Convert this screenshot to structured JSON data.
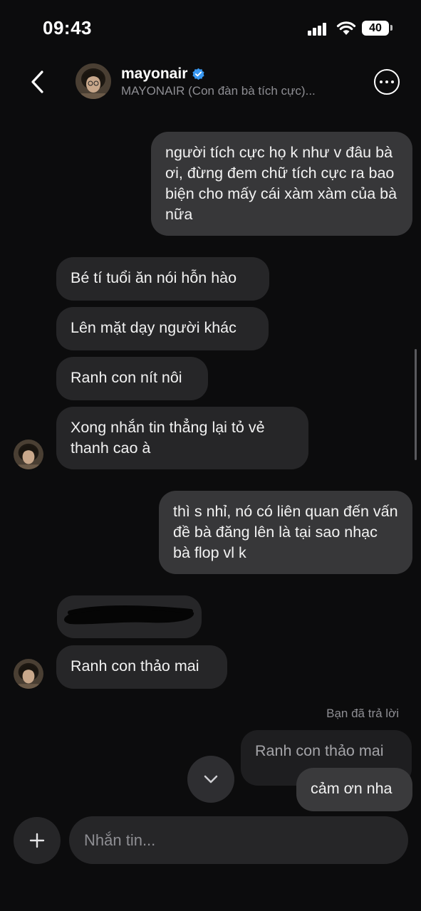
{
  "status_bar": {
    "time": "09:43",
    "battery": "40",
    "icons": [
      "signal-icon",
      "wifi-icon",
      "battery-icon"
    ]
  },
  "header": {
    "name": "mayonair",
    "verified": true,
    "subtitle": "MAYONAIR (Con đàn bà tích cực)...",
    "icons": [
      "back-arrow-icon",
      "verified-badge-icon",
      "more-options-icon"
    ]
  },
  "messages": {
    "m1": "người tích cực họ k như v đâu bà ơi, đừng đem chữ tích cực ra bao biện cho mấy cái xàm xàm của bà nữa",
    "m2": "Bé tí tuổi ăn nói hỗn hào",
    "m3": "Lên mặt dạy người khác",
    "m4": "Ranh con nít nôi",
    "m5": "Xong nhắn tin thẳng lại tỏ vẻ thanh cao à",
    "m6": "thì s nhỉ, nó có liên quan đến vấn đề bà đăng lên là tại sao nhạc bà flop vl k",
    "m8": "Ranh con thảo mai",
    "reply_label": "Bạn đã trả lời",
    "reply_quote": "Ranh con thảo mai",
    "m9": "cảm ơn nha"
  },
  "composer": {
    "placeholder": "Nhắn tin...",
    "icons": [
      "plus-icon",
      "chevron-down-icon"
    ]
  },
  "colors": {
    "background": "#0c0c0d",
    "outgoing_bubble": "#373739",
    "incoming_bubble": "#262628",
    "verified": "#3897f0",
    "muted_text": "#8e8e93"
  }
}
